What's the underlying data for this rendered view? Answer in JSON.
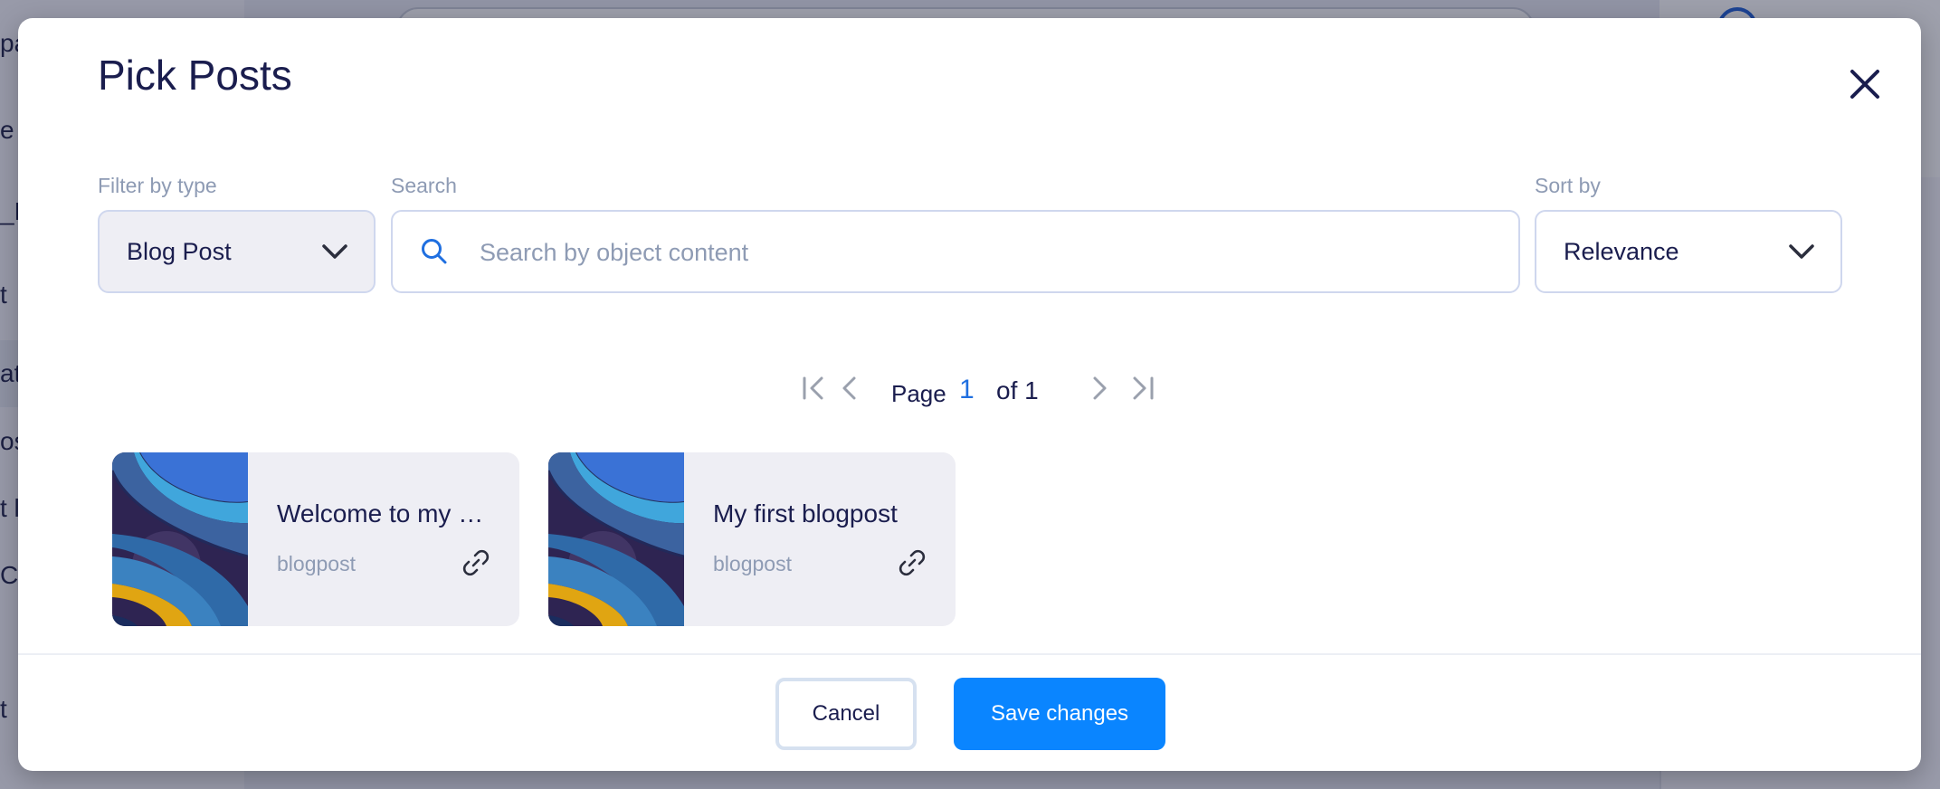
{
  "background": {
    "sidebar_fragments": [
      "pa",
      "e",
      "_Li",
      "t",
      "ate",
      "ost",
      "t l",
      "CT",
      "t"
    ]
  },
  "modal": {
    "title": "Pick Posts",
    "filter": {
      "label": "Filter by type",
      "value": "Blog Post"
    },
    "search": {
      "label": "Search",
      "placeholder": "Search by object content",
      "value": ""
    },
    "sort": {
      "label": "Sort by",
      "value": "Relevance"
    },
    "pagination": {
      "page_word": "Page",
      "current": "1",
      "of_text": "of 1"
    },
    "cards": [
      {
        "title": "Welcome to my …",
        "type": "blogpost"
      },
      {
        "title": "My first blogpost",
        "type": "blogpost"
      }
    ],
    "footer": {
      "cancel_label": "Cancel",
      "save_label": "Save changes"
    }
  },
  "colors": {
    "accent": "#0a85ff",
    "title": "#1a1d4e",
    "muted": "#8e9bb4",
    "card_bg": "#eeeef4"
  }
}
